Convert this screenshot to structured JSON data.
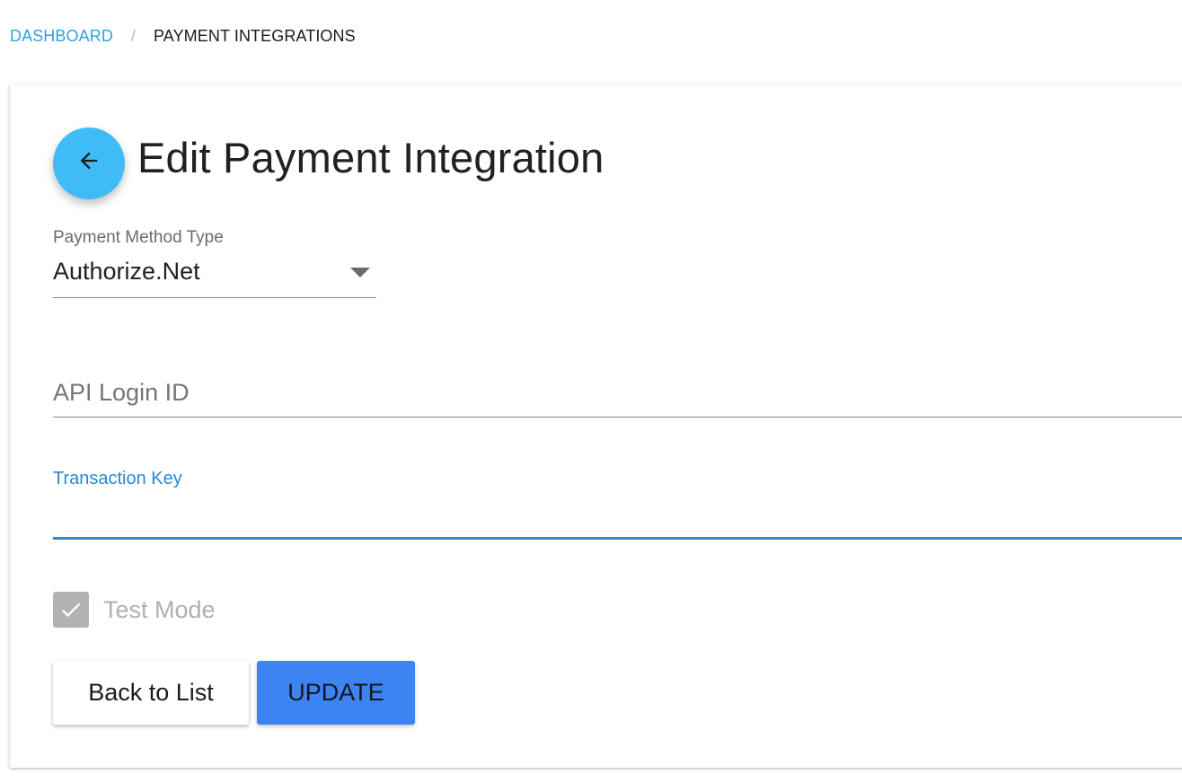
{
  "breadcrumb": {
    "home": "DASHBOARD",
    "separator": "/",
    "current": "PAYMENT INTEGRATIONS"
  },
  "header": {
    "back_icon": "arrow-left-icon",
    "title": "Edit Payment Integration"
  },
  "form": {
    "payment_method": {
      "label": "Payment Method Type",
      "value": "Authorize.Net",
      "icon": "caret-down-icon"
    },
    "api_login": {
      "placeholder": "API Login ID",
      "value": ""
    },
    "transaction_key": {
      "label": "Transaction Key",
      "value": ""
    },
    "test_mode": {
      "label": "Test Mode",
      "checked": true,
      "icon": "check-icon"
    }
  },
  "actions": {
    "back_label": "Back to List",
    "update_label": "UPDATE"
  },
  "colors": {
    "link": "#2ba3de",
    "fab": "#3dbcf7",
    "focus": "#2e8fd7",
    "primary_button": "#3e83f2",
    "checkbox_disabled": "#b2b2b2"
  }
}
